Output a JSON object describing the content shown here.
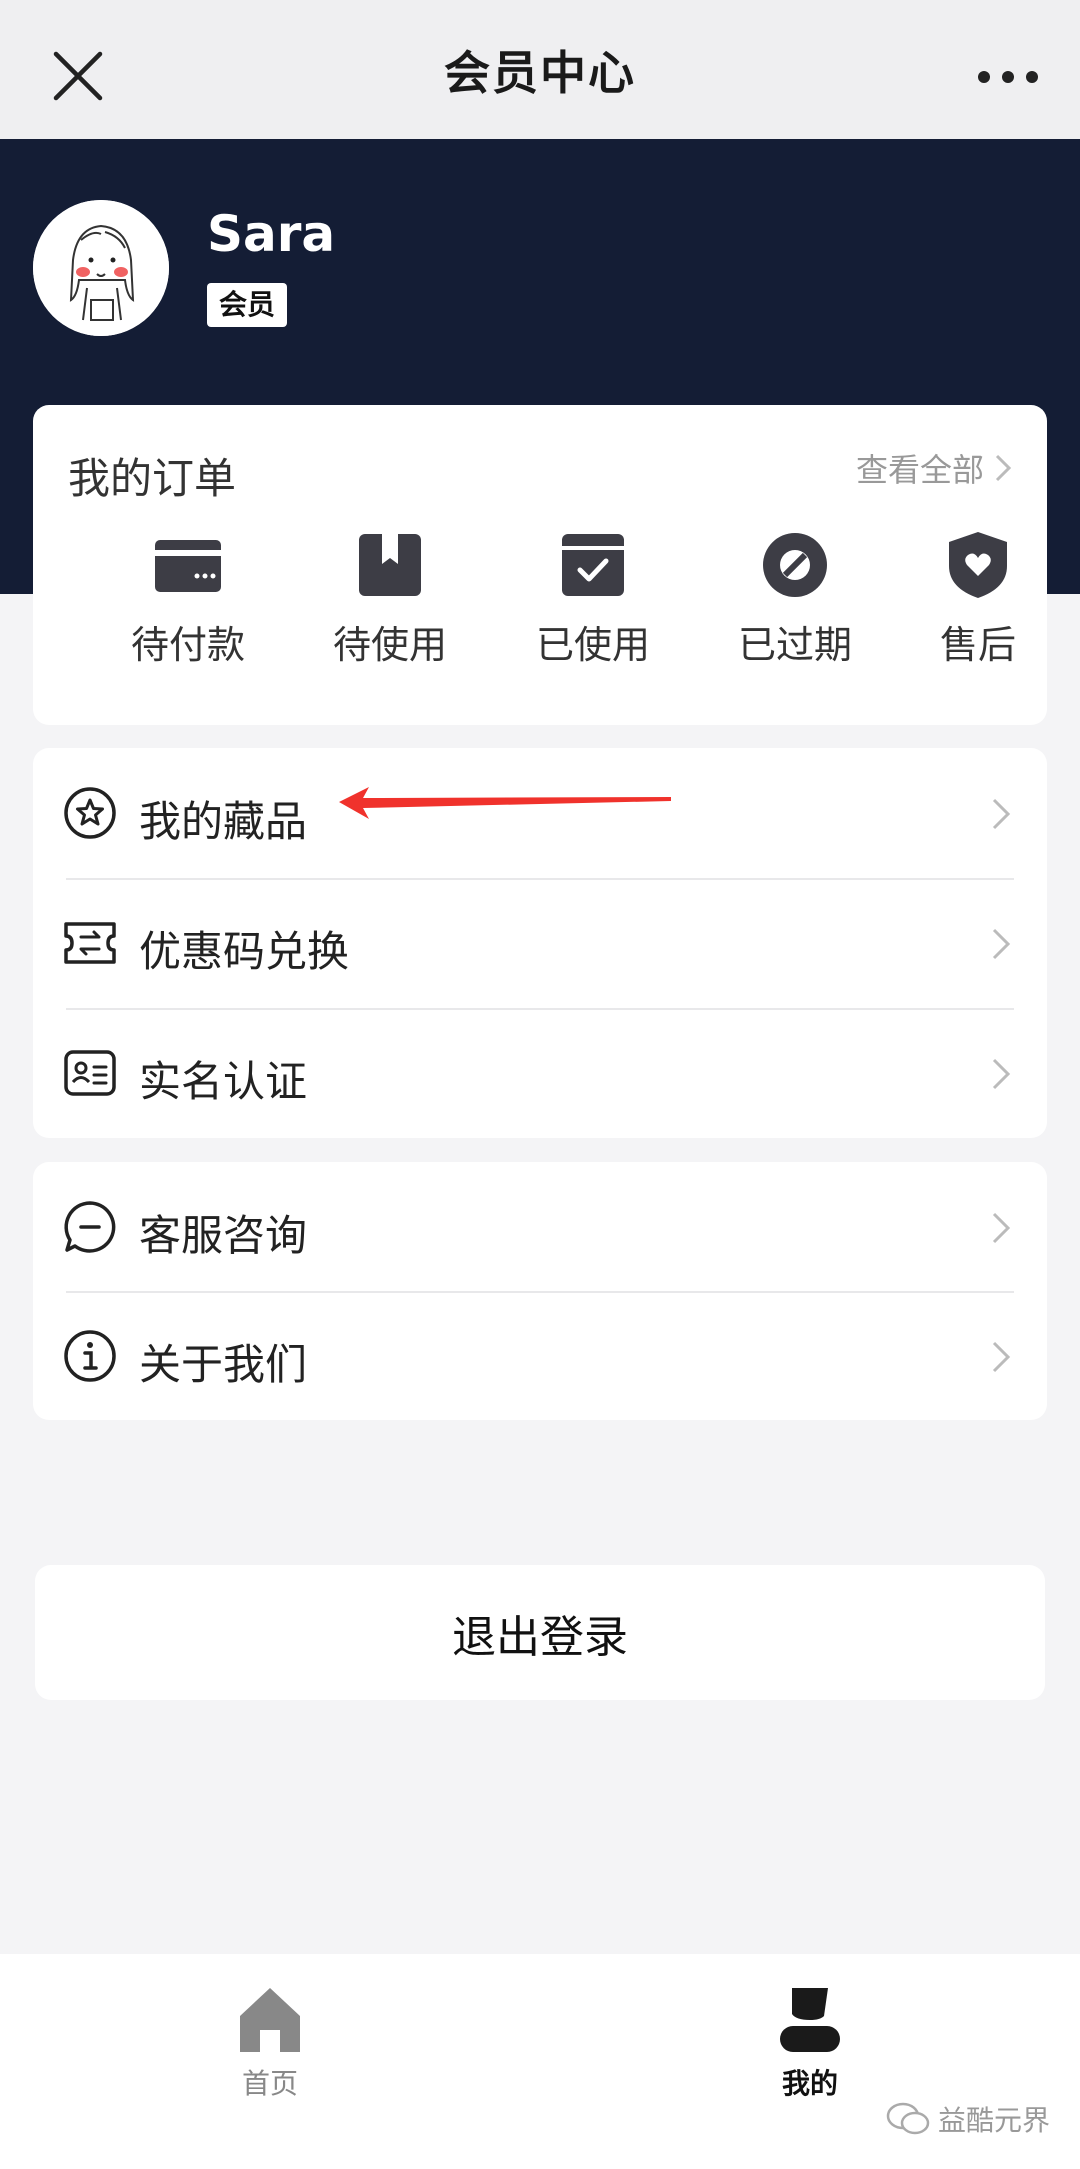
{
  "header": {
    "title": "会员中心"
  },
  "profile": {
    "name": "Sara",
    "badge": "会员"
  },
  "orders": {
    "title": "我的订单",
    "view_all": "查看全部",
    "items": [
      {
        "label": "待付款",
        "icon": "card-icon"
      },
      {
        "label": "待使用",
        "icon": "box-icon"
      },
      {
        "label": "已使用",
        "icon": "box-check-icon"
      },
      {
        "label": "已过期",
        "icon": "ban-icon"
      },
      {
        "label": "售后",
        "icon": "shield-heart-icon"
      }
    ]
  },
  "menu1": [
    {
      "label": "我的藏品",
      "icon": "star-circle-icon"
    },
    {
      "label": "优惠码兑换",
      "icon": "ticket-icon"
    },
    {
      "label": "实名认证",
      "icon": "id-card-icon"
    }
  ],
  "menu2": [
    {
      "label": "客服咨询",
      "icon": "chat-icon"
    },
    {
      "label": "关于我们",
      "icon": "info-icon"
    }
  ],
  "logout": "退出登录",
  "tabbar": [
    {
      "label": "首页",
      "icon": "home-icon",
      "active": false
    },
    {
      "label": "我的",
      "icon": "user-icon",
      "active": true
    }
  ],
  "watermark": "益酷元界",
  "colors": {
    "hero": "#141d35",
    "annotation": "#f0322c",
    "icon": "#3d3d45"
  }
}
